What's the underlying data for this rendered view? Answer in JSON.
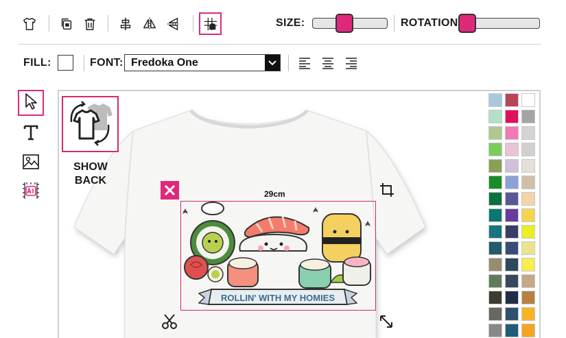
{
  "toolbar": {
    "size_label": "SIZE:",
    "rotation_label": "ROTATION:",
    "size_value": 0.4,
    "rotation_value": 0.0,
    "icons": [
      "tshirt-icon",
      "duplicate-icon",
      "trash-icon",
      "align-center-vertical-icon",
      "flip-horizontal-icon",
      "flip-vertical-icon",
      "grid-snap-icon"
    ]
  },
  "text_bar": {
    "fill_label": "FILL:",
    "fill_color": "#ffffff",
    "font_label": "FONT:",
    "font_value": "Fredoka One",
    "align_icons": [
      "align-left-icon",
      "align-center-icon",
      "align-right-icon"
    ]
  },
  "side_tools": [
    "select-cursor-icon",
    "text-tool-icon",
    "image-tool-icon",
    "ai-tool-icon"
  ],
  "show_back": {
    "label_line1": "SHOW",
    "label_line2": "BACK"
  },
  "design": {
    "size_text": "29cm",
    "banner_text": "ROLLIN' WITH MY HOMIES"
  },
  "accent_color": "#e0287a",
  "palette": [
    [
      "#a8c8dc",
      "#b84458",
      "#ffffff"
    ],
    [
      "#b2e0c8",
      "#e0105a",
      "#a4a4a4"
    ],
    [
      "#b0c890",
      "#f07ab4",
      "#d4d4d4"
    ],
    [
      "#7ccc5c",
      "#e8c4d4",
      "#d4d0d0"
    ],
    [
      "#88a058",
      "#d0c0dc",
      "#e4e0d8"
    ],
    [
      "#1a8c28",
      "#8ca0d8",
      "#d0c0a8"
    ],
    [
      "#0a7040",
      "#585898",
      "#f4d4a8"
    ],
    [
      "#0a7870",
      "#683c9c",
      "#f4d450"
    ],
    [
      "#187480",
      "#3c3c68",
      "#e8f024"
    ],
    [
      "#205c6c",
      "#384c78",
      "#ece48c"
    ],
    [
      "#988c70",
      "#30485c",
      "#f8ec50"
    ],
    [
      "#607c5c",
      "#38485c",
      "#c4a888"
    ],
    [
      "#3c3c30",
      "#202c48",
      "#b88040"
    ],
    [
      "#686860",
      "#305070",
      "#f8b428"
    ],
    [
      "#888888",
      "#205c78",
      "#f4a420"
    ]
  ]
}
